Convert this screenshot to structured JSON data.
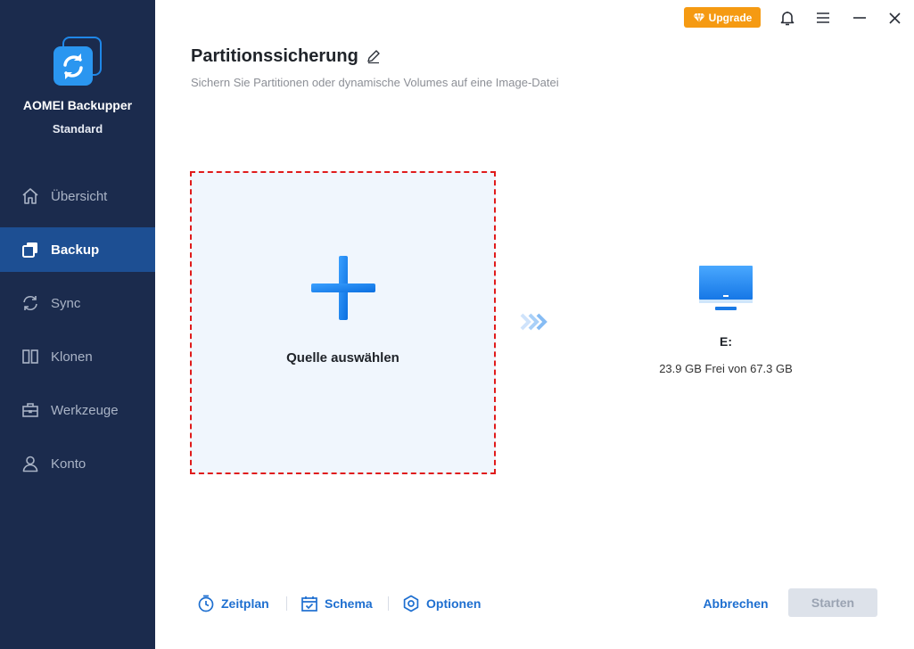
{
  "app": {
    "name": "AOMEI Backupper",
    "edition": "Standard"
  },
  "sidebar": {
    "items": [
      {
        "label": "Übersicht",
        "icon": "home-icon",
        "active": false
      },
      {
        "label": "Backup",
        "icon": "backup-icon",
        "active": true
      },
      {
        "label": "Sync",
        "icon": "sync-icon",
        "active": false
      },
      {
        "label": "Klonen",
        "icon": "clone-icon",
        "active": false
      },
      {
        "label": "Werkzeuge",
        "icon": "toolbox-icon",
        "active": false
      },
      {
        "label": "Konto",
        "icon": "user-icon",
        "active": false
      }
    ]
  },
  "topbar": {
    "upgrade_label": "Upgrade"
  },
  "header": {
    "title": "Partitionssicherung",
    "subtitle": "Sichern Sie Partitionen oder dynamische Volumes auf eine Image-Datei"
  },
  "source": {
    "label": "Quelle auswählen"
  },
  "destination": {
    "drive": "E:",
    "space": "23.9 GB Frei von 67.3 GB"
  },
  "bottom": {
    "options": [
      {
        "label": "Zeitplan",
        "icon": "clock-icon"
      },
      {
        "label": "Schema",
        "icon": "calendar-check-icon"
      },
      {
        "label": "Optionen",
        "icon": "gear-icon"
      }
    ],
    "cancel_label": "Abbrechen",
    "start_label": "Starten"
  },
  "colors": {
    "sidebar_bg": "#1b2b4d",
    "active_nav": "#1d4f93",
    "accent": "#1e6fd0",
    "upgrade": "#f59a12",
    "source_border": "#e01b1b"
  }
}
